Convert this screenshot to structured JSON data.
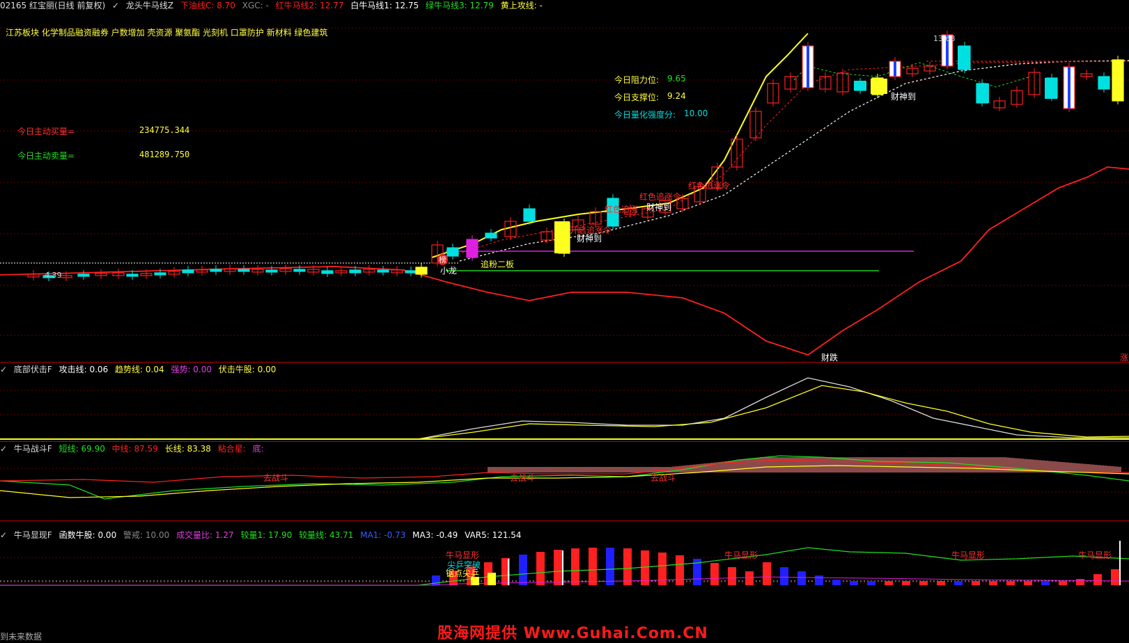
{
  "main": {
    "header": {
      "code_name": "02165 红宝丽(日线 前复权)",
      "indicator": "龙头牛马线Z",
      "items": [
        {
          "label": "下油线C: 8.70",
          "color": "#ff2020"
        },
        {
          "label": "XGC: -",
          "color": "#888888"
        },
        {
          "label": "红牛马线2: 12.77",
          "color": "#ff2020"
        },
        {
          "label": "白牛马线1: 12.75",
          "color": "#ffffff"
        },
        {
          "label": "绿牛马线3: 12.79",
          "color": "#20e020"
        },
        {
          "label": "黄上攻线: -",
          "color": "#ffff40"
        }
      ]
    },
    "concepts": "江苏板块  化学制品融资融券 户数增加 壳资源   聚氨酯 光刻机 口罩防护 新材料 绿色建筑",
    "buy_label": "今日主动买量=",
    "buy_value": "234775.344",
    "sell_label": "今日主动卖量=",
    "sell_value": "481289.750",
    "resist_label": "今日阻力位:",
    "resist_value": "9.65",
    "support_label": "今日支撑位:",
    "support_value": "9.24",
    "strength_label": "今日量化强度分:",
    "strength_value": "10.00",
    "high_mark": "13.68",
    "low_mark": "4.39",
    "annotations": {
      "caishen1": "财神到",
      "caishen2": "财神到",
      "caishen3": "财神到",
      "hongse1": "红色追涨",
      "hongse2": "红色追涨令",
      "hongse3": "开启追涨令",
      "hongse4": "红色追涨令",
      "xiaolong": "小龙",
      "zhuifen": "追粉二板",
      "bang": "榜",
      "caitie": "财跌",
      "zhang": "涨"
    }
  },
  "panel1": {
    "title": "底部伏击F",
    "items": [
      {
        "label": "攻击线: 0.06",
        "color": "#ffffff"
      },
      {
        "label": "趋势线: 0.04",
        "color": "#ffff40"
      },
      {
        "label": "强势: 0.00",
        "color": "#e040e0"
      },
      {
        "label": "伏击牛股: 0.00",
        "color": "#ffff40"
      }
    ]
  },
  "panel2": {
    "title": "牛马战斗F",
    "items": [
      {
        "label": "短线: 69.90",
        "color": "#20e020"
      },
      {
        "label": "中线: 87.59",
        "color": "#ff2020"
      },
      {
        "label": "长线: 83.38",
        "color": "#ffff40"
      },
      {
        "label": "粘合星:",
        "color": "#ff2020"
      },
      {
        "label": "底:",
        "color": "#e040e0"
      }
    ],
    "qzd": "去战斗"
  },
  "panel3": {
    "title": "牛马显现F",
    "items": [
      {
        "label": "函数牛股: 0.00",
        "color": "#ffffff"
      },
      {
        "label": "警戒: 10.00",
        "color": "#888888"
      },
      {
        "label": "成交量比: 1.27",
        "color": "#e040e0"
      },
      {
        "label": "较量1: 17.90",
        "color": "#20e020"
      },
      {
        "label": "较量线: 43.71",
        "color": "#20e020"
      },
      {
        "label": "MA1: -0.73",
        "color": "#3060ff"
      },
      {
        "label": "MA3: -0.49",
        "color": "#ffffff"
      },
      {
        "label": "VAR5: 121.54",
        "color": "#ffffff"
      }
    ],
    "niuma": "牛马显形",
    "jianfeng": "尖乒突破",
    "jufeng": "锯点尖乒"
  },
  "footer": "到未来数据",
  "watermark": "股海网提供 Www.Guhai.Com.CN",
  "colors": {
    "up": "#ff2020",
    "down": "#00e0e0",
    "grid": "#7a0000",
    "magenta": "#e020e0",
    "yellow": "#ffff20"
  }
}
